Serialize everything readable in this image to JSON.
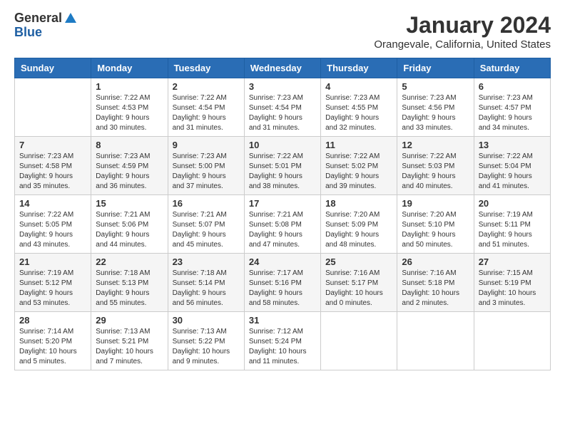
{
  "header": {
    "logo_general": "General",
    "logo_blue": "Blue",
    "month_year": "January 2024",
    "location": "Orangevale, California, United States"
  },
  "weekdays": [
    "Sunday",
    "Monday",
    "Tuesday",
    "Wednesday",
    "Thursday",
    "Friday",
    "Saturday"
  ],
  "weeks": [
    [
      {
        "day": "",
        "info": ""
      },
      {
        "day": "1",
        "info": "Sunrise: 7:22 AM\nSunset: 4:53 PM\nDaylight: 9 hours\nand 30 minutes."
      },
      {
        "day": "2",
        "info": "Sunrise: 7:22 AM\nSunset: 4:54 PM\nDaylight: 9 hours\nand 31 minutes."
      },
      {
        "day": "3",
        "info": "Sunrise: 7:23 AM\nSunset: 4:54 PM\nDaylight: 9 hours\nand 31 minutes."
      },
      {
        "day": "4",
        "info": "Sunrise: 7:23 AM\nSunset: 4:55 PM\nDaylight: 9 hours\nand 32 minutes."
      },
      {
        "day": "5",
        "info": "Sunrise: 7:23 AM\nSunset: 4:56 PM\nDaylight: 9 hours\nand 33 minutes."
      },
      {
        "day": "6",
        "info": "Sunrise: 7:23 AM\nSunset: 4:57 PM\nDaylight: 9 hours\nand 34 minutes."
      }
    ],
    [
      {
        "day": "7",
        "info": "Sunrise: 7:23 AM\nSunset: 4:58 PM\nDaylight: 9 hours\nand 35 minutes."
      },
      {
        "day": "8",
        "info": "Sunrise: 7:23 AM\nSunset: 4:59 PM\nDaylight: 9 hours\nand 36 minutes."
      },
      {
        "day": "9",
        "info": "Sunrise: 7:23 AM\nSunset: 5:00 PM\nDaylight: 9 hours\nand 37 minutes."
      },
      {
        "day": "10",
        "info": "Sunrise: 7:22 AM\nSunset: 5:01 PM\nDaylight: 9 hours\nand 38 minutes."
      },
      {
        "day": "11",
        "info": "Sunrise: 7:22 AM\nSunset: 5:02 PM\nDaylight: 9 hours\nand 39 minutes."
      },
      {
        "day": "12",
        "info": "Sunrise: 7:22 AM\nSunset: 5:03 PM\nDaylight: 9 hours\nand 40 minutes."
      },
      {
        "day": "13",
        "info": "Sunrise: 7:22 AM\nSunset: 5:04 PM\nDaylight: 9 hours\nand 41 minutes."
      }
    ],
    [
      {
        "day": "14",
        "info": "Sunrise: 7:22 AM\nSunset: 5:05 PM\nDaylight: 9 hours\nand 43 minutes."
      },
      {
        "day": "15",
        "info": "Sunrise: 7:21 AM\nSunset: 5:06 PM\nDaylight: 9 hours\nand 44 minutes."
      },
      {
        "day": "16",
        "info": "Sunrise: 7:21 AM\nSunset: 5:07 PM\nDaylight: 9 hours\nand 45 minutes."
      },
      {
        "day": "17",
        "info": "Sunrise: 7:21 AM\nSunset: 5:08 PM\nDaylight: 9 hours\nand 47 minutes."
      },
      {
        "day": "18",
        "info": "Sunrise: 7:20 AM\nSunset: 5:09 PM\nDaylight: 9 hours\nand 48 minutes."
      },
      {
        "day": "19",
        "info": "Sunrise: 7:20 AM\nSunset: 5:10 PM\nDaylight: 9 hours\nand 50 minutes."
      },
      {
        "day": "20",
        "info": "Sunrise: 7:19 AM\nSunset: 5:11 PM\nDaylight: 9 hours\nand 51 minutes."
      }
    ],
    [
      {
        "day": "21",
        "info": "Sunrise: 7:19 AM\nSunset: 5:12 PM\nDaylight: 9 hours\nand 53 minutes."
      },
      {
        "day": "22",
        "info": "Sunrise: 7:18 AM\nSunset: 5:13 PM\nDaylight: 9 hours\nand 55 minutes."
      },
      {
        "day": "23",
        "info": "Sunrise: 7:18 AM\nSunset: 5:14 PM\nDaylight: 9 hours\nand 56 minutes."
      },
      {
        "day": "24",
        "info": "Sunrise: 7:17 AM\nSunset: 5:16 PM\nDaylight: 9 hours\nand 58 minutes."
      },
      {
        "day": "25",
        "info": "Sunrise: 7:16 AM\nSunset: 5:17 PM\nDaylight: 10 hours\nand 0 minutes."
      },
      {
        "day": "26",
        "info": "Sunrise: 7:16 AM\nSunset: 5:18 PM\nDaylight: 10 hours\nand 2 minutes."
      },
      {
        "day": "27",
        "info": "Sunrise: 7:15 AM\nSunset: 5:19 PM\nDaylight: 10 hours\nand 3 minutes."
      }
    ],
    [
      {
        "day": "28",
        "info": "Sunrise: 7:14 AM\nSunset: 5:20 PM\nDaylight: 10 hours\nand 5 minutes."
      },
      {
        "day": "29",
        "info": "Sunrise: 7:13 AM\nSunset: 5:21 PM\nDaylight: 10 hours\nand 7 minutes."
      },
      {
        "day": "30",
        "info": "Sunrise: 7:13 AM\nSunset: 5:22 PM\nDaylight: 10 hours\nand 9 minutes."
      },
      {
        "day": "31",
        "info": "Sunrise: 7:12 AM\nSunset: 5:24 PM\nDaylight: 10 hours\nand 11 minutes."
      },
      {
        "day": "",
        "info": ""
      },
      {
        "day": "",
        "info": ""
      },
      {
        "day": "",
        "info": ""
      }
    ]
  ]
}
